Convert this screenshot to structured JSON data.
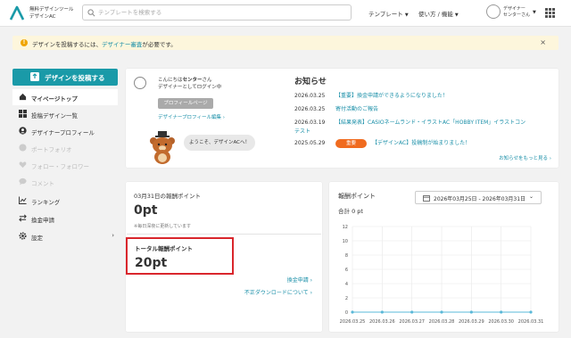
{
  "header": {
    "brand_line1": "無料デザインツール",
    "brand_line2": "デザインAC",
    "search_placeholder": "テンプレートを検索する",
    "nav": [
      "テンプレート",
      "使い方 / 機能"
    ],
    "user_line1": "デザイナー",
    "user_line2": "センターさん"
  },
  "alert": {
    "text_before": "デザインを投稿するには、",
    "link": "デザイナー審査",
    "text_after": "が必要です。",
    "close": "×"
  },
  "sidebar": {
    "post_button": "デザインを投稿する",
    "items": [
      {
        "label": "マイページトップ",
        "icon": "home-icon",
        "state": "active"
      },
      {
        "label": "投稿デザイン一覧",
        "icon": "grid-icon",
        "state": "normal"
      },
      {
        "label": "デザイナープロフィール",
        "icon": "user-icon",
        "state": "normal"
      },
      {
        "label": "ポートフォリオ",
        "icon": "palette-icon",
        "state": "disabled"
      },
      {
        "label": "フォロー・フォロワー",
        "icon": "heart-icon",
        "state": "disabled"
      },
      {
        "label": "コメント",
        "icon": "comment-icon",
        "state": "disabled"
      },
      {
        "label": "ランキング",
        "icon": "chart-icon",
        "state": "normal"
      },
      {
        "label": "換金申請",
        "icon": "exchange-icon",
        "state": "normal"
      },
      {
        "label": "設定",
        "icon": "gear-icon",
        "state": "normal"
      }
    ]
  },
  "profile": {
    "greeting_prefix": "こんにちは",
    "name": "センター",
    "greeting_suffix": "さん",
    "login_text": "デザイナーとしてログイン中",
    "profile_button": "プロフィールページ",
    "edit_link": "デザイナープロフィール編集 ›",
    "bubble": "ようこそ、デザインACへ！"
  },
  "news": {
    "title": "お知らせ",
    "items": [
      {
        "date": "2026.03.25",
        "text": "【重要】換金申請ができるようになりました！"
      },
      {
        "date": "2026.03.25",
        "text": "寄付活動のご報告"
      },
      {
        "date": "2026.03.19",
        "text": "【結果発表】CASIOネームランド・イラストAC「HOBBY ITEM」イラストコン"
      },
      {
        "date": "",
        "text": "テスト"
      },
      {
        "date": "2025.05.29",
        "badge": "重要",
        "text": "【デザインAC】投稿制が始まりました！"
      }
    ],
    "more": "お知らせをもっと見る ›"
  },
  "points": {
    "label": "03月31日の報酬ポイント",
    "value": "0pt",
    "note": "※毎日深夜に更新しています",
    "total_label": "トータル報酬ポイント",
    "total_value": "20pt",
    "exchange_link": "換金申請 ›",
    "fraud_link": "不正ダウンロードについて ›"
  },
  "chart_panel": {
    "title": "報酬ポイント",
    "total": "合計 0 pt",
    "date_range": "2026年03月25日 - 2026年03月31日"
  },
  "chart_data": {
    "type": "line",
    "x": [
      "2026.03.25",
      "2026.03.26",
      "2026.03.27",
      "2026.03.28",
      "2026.03.29",
      "2026.03.30",
      "2026.03.31"
    ],
    "series": [
      {
        "values": [
          0,
          0,
          0,
          0,
          0,
          0,
          0
        ]
      }
    ],
    "yticks": [
      0,
      2,
      4,
      6,
      8,
      10,
      12
    ],
    "ylim": [
      0,
      12
    ],
    "color": "#5ab8d8"
  },
  "colors": {
    "brand": "#1a9aa8",
    "alert_bg": "#fdf6dc",
    "highlight": "#d9262c",
    "badge": "#f06b1f"
  }
}
